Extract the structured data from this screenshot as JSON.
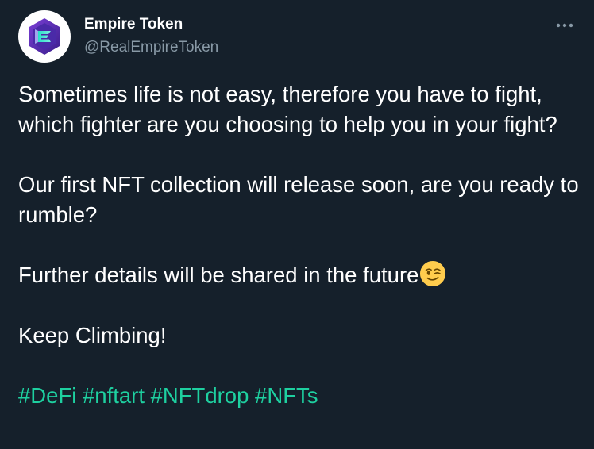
{
  "account": {
    "display_name": "Empire Token",
    "handle": "@RealEmpireToken",
    "avatar_icon": "empire-token-logo"
  },
  "menu": {
    "more_icon": "more-horizontal-icon"
  },
  "tweet": {
    "paragraphs": [
      "Sometimes life is not easy, therefore you have to fight, which fighter are you choosing to help you in your fight?",
      "Our first NFT collection will release soon, are you ready to rumble?",
      "Further details will be shared in the future",
      "Keep Climbing!"
    ],
    "emoji": "winking-face",
    "hashtags": [
      "#DeFi",
      "#nftart",
      "#NFTdrop",
      "#NFTs"
    ]
  },
  "colors": {
    "background": "#15202b",
    "text": "#ffffff",
    "secondary_text": "#8899a6",
    "hashtag": "#1ed0a0"
  }
}
